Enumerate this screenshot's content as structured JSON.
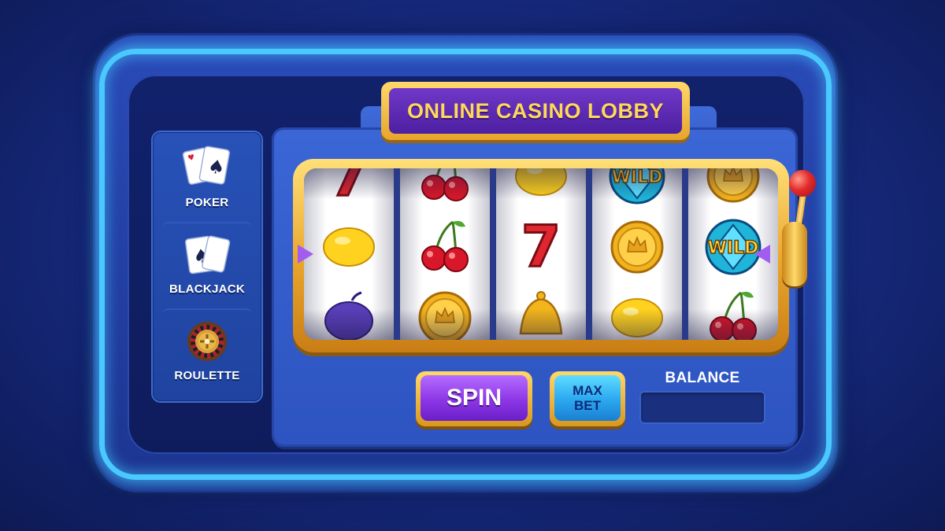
{
  "lobby": {
    "title": "ONLINE CASINO LOBBY"
  },
  "sidebar": {
    "items": [
      {
        "label": "POKER",
        "icon": "playing-cards-icon"
      },
      {
        "label": "BLACKJACK",
        "icon": "blackjack-cards-icon"
      },
      {
        "label": "ROULETTE",
        "icon": "roulette-wheel-icon"
      }
    ]
  },
  "reels": [
    [
      "seven",
      "lemon",
      "plum"
    ],
    [
      "cherry",
      "cherry",
      "coin"
    ],
    [
      "lemon",
      "seven",
      "bell"
    ],
    [
      "wild",
      "coin",
      "lemon"
    ],
    [
      "coin",
      "wild",
      "cherry"
    ]
  ],
  "wild_label": "WILD",
  "seven_label": "7",
  "controls": {
    "spin_label": "SPIN",
    "maxbet_line1": "MAX",
    "maxbet_line2": "BET",
    "balance_label": "BALANCE",
    "balance_value": ""
  },
  "colors": {
    "accent_gold": "#ffd85a",
    "neon_blue": "#49c9ff",
    "spin_purple": "#8c36e6",
    "maxbet_cyan": "#2aa7ef"
  }
}
